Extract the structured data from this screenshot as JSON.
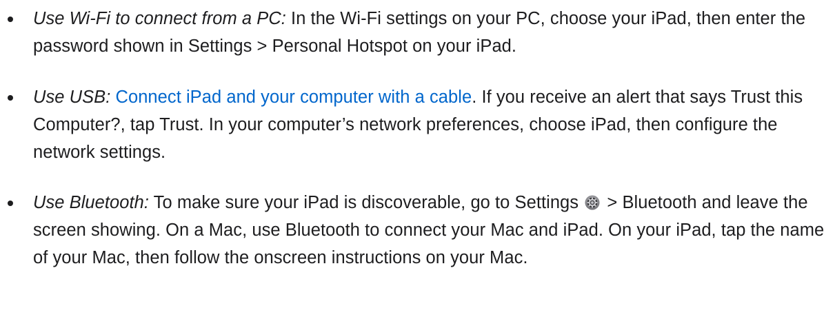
{
  "items": [
    {
      "lead": "Use Wi-Fi to connect from a PC:",
      "body": " In the Wi-Fi settings on your PC, choose your iPad, then enter the password shown in Settings > Personal Hotspot on your iPad."
    },
    {
      "lead": "Use USB:",
      "link": "Connect iPad and your computer with a cable",
      "body": ". If you receive an alert that says Trust this Computer?, tap Trust. In your computer’s network preferences, choose iPad, then configure the network settings."
    },
    {
      "lead": "Use Bluetooth:",
      "body_before_icon": " To make sure your iPad is discoverable, go to Settings",
      "icon": "settings-gear-icon",
      "body_after_icon": " > Bluetooth and leave the screen showing. On a Mac, use Bluetooth to connect your Mac and iPad. On your iPad, tap the name of your Mac, then follow the onscreen instructions on your Mac."
    }
  ],
  "colors": {
    "text": "#1d1d1f",
    "link": "#0066cc",
    "background": "#ffffff"
  }
}
